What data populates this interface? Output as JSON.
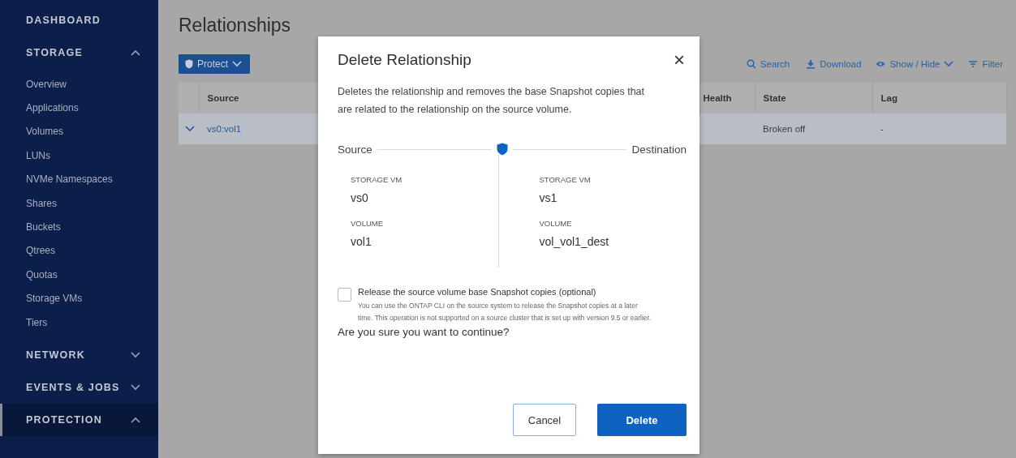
{
  "sidebar": {
    "sections": [
      {
        "label": "DASHBOARD",
        "kind": "link",
        "selected": false
      },
      {
        "label": "STORAGE",
        "kind": "group",
        "expanded": true,
        "selected": false,
        "children": [
          {
            "label": "Overview"
          },
          {
            "label": "Applications"
          },
          {
            "label": "Volumes"
          },
          {
            "label": "LUNs"
          },
          {
            "label": "NVMe Namespaces"
          },
          {
            "label": "Shares"
          },
          {
            "label": "Buckets"
          },
          {
            "label": "Qtrees"
          },
          {
            "label": "Quotas"
          },
          {
            "label": "Storage VMs"
          },
          {
            "label": "Tiers"
          }
        ]
      },
      {
        "label": "NETWORK",
        "kind": "group",
        "expanded": false,
        "selected": false
      },
      {
        "label": "EVENTS & JOBS",
        "kind": "group",
        "expanded": false,
        "selected": false
      },
      {
        "label": "PROTECTION",
        "kind": "group",
        "expanded": true,
        "selected": true
      }
    ]
  },
  "main": {
    "title": "Relationships",
    "protect_button": {
      "label": "Protect"
    },
    "actions": [
      {
        "label": "Search",
        "kind": "search"
      },
      {
        "label": "Download",
        "kind": "download"
      },
      {
        "label": "Show / Hide",
        "kind": "eye",
        "has_menu": true
      },
      {
        "label": "Filter",
        "kind": "filter"
      }
    ],
    "table": {
      "columns": [
        {
          "label": "Source"
        },
        {
          "label": "Health"
        },
        {
          "label": "State"
        },
        {
          "label": "Lag"
        }
      ],
      "rows": [
        {
          "selected": true,
          "expanded": false,
          "source": "vs0:vol1",
          "state": "Broken off",
          "lag": "-"
        }
      ]
    }
  },
  "dialog": {
    "title": "Delete Relationship",
    "close": "×",
    "description": "Deletes the relationship and removes the base Snapshot copies that are related to the relationship on the source volume.",
    "source_label": "Source",
    "destination_label": "Destination",
    "source": [
      {
        "label": "STORAGE VM",
        "value": "vs0"
      },
      {
        "label": "VOLUME",
        "value": "vol1"
      }
    ],
    "destination": [
      {
        "label": "STORAGE VM",
        "value": "vs1"
      },
      {
        "label": "VOLUME",
        "value": "vol_vol1_dest"
      }
    ],
    "checkbox": {
      "label": "Release the source volume base Snapshot copies (optional)",
      "checked": false,
      "help": "You can use the ONTAP CLI on the source system to release the Snapshot copies at a later time. This operation is not supported on a source cluster that is set up with version 9.5 or earlier."
    },
    "question": "Are you sure you want to continue?",
    "buttons": [
      {
        "label": "Cancel",
        "kind": "secondary"
      },
      {
        "label": "Delete",
        "kind": "primary"
      }
    ]
  }
}
